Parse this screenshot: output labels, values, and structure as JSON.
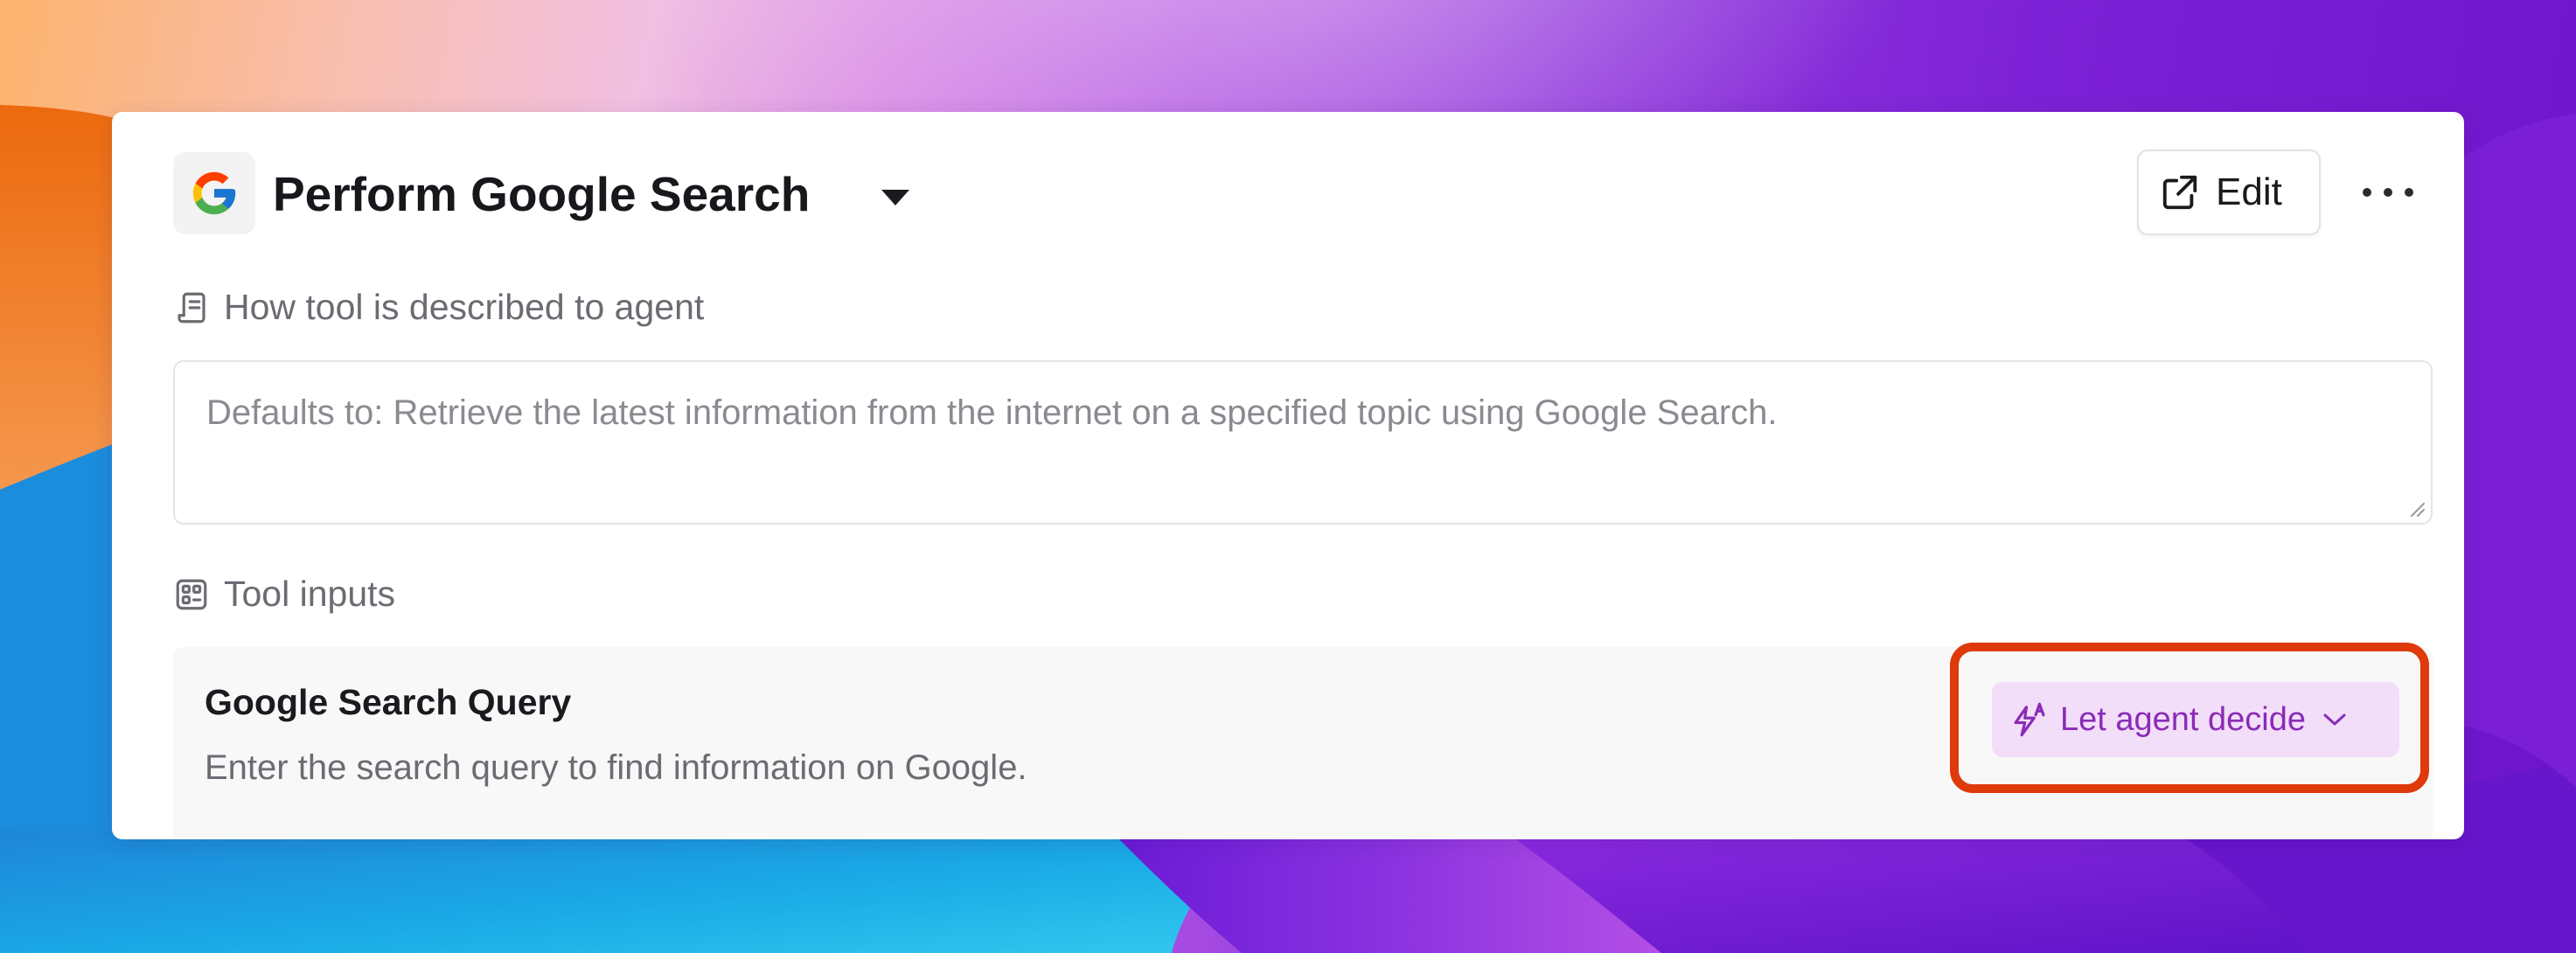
{
  "tool": {
    "title": "Perform Google Search",
    "logo_icon": "google-g-logo",
    "edit_label": "Edit"
  },
  "description": {
    "label": "How tool is described to agent",
    "placeholder": "Defaults to: Retrieve the latest information from the internet on a specified topic using Google Search."
  },
  "inputs": {
    "label": "Tool inputs",
    "items": [
      {
        "name": "Google Search Query",
        "hint": "Enter the search query to find information on Google.",
        "mode": "Let agent decide"
      }
    ]
  },
  "colors": {
    "accent_pill_bg": "#f2def9",
    "accent_pill_text": "#8a2bb6",
    "highlight_border": "#de3a0c"
  }
}
